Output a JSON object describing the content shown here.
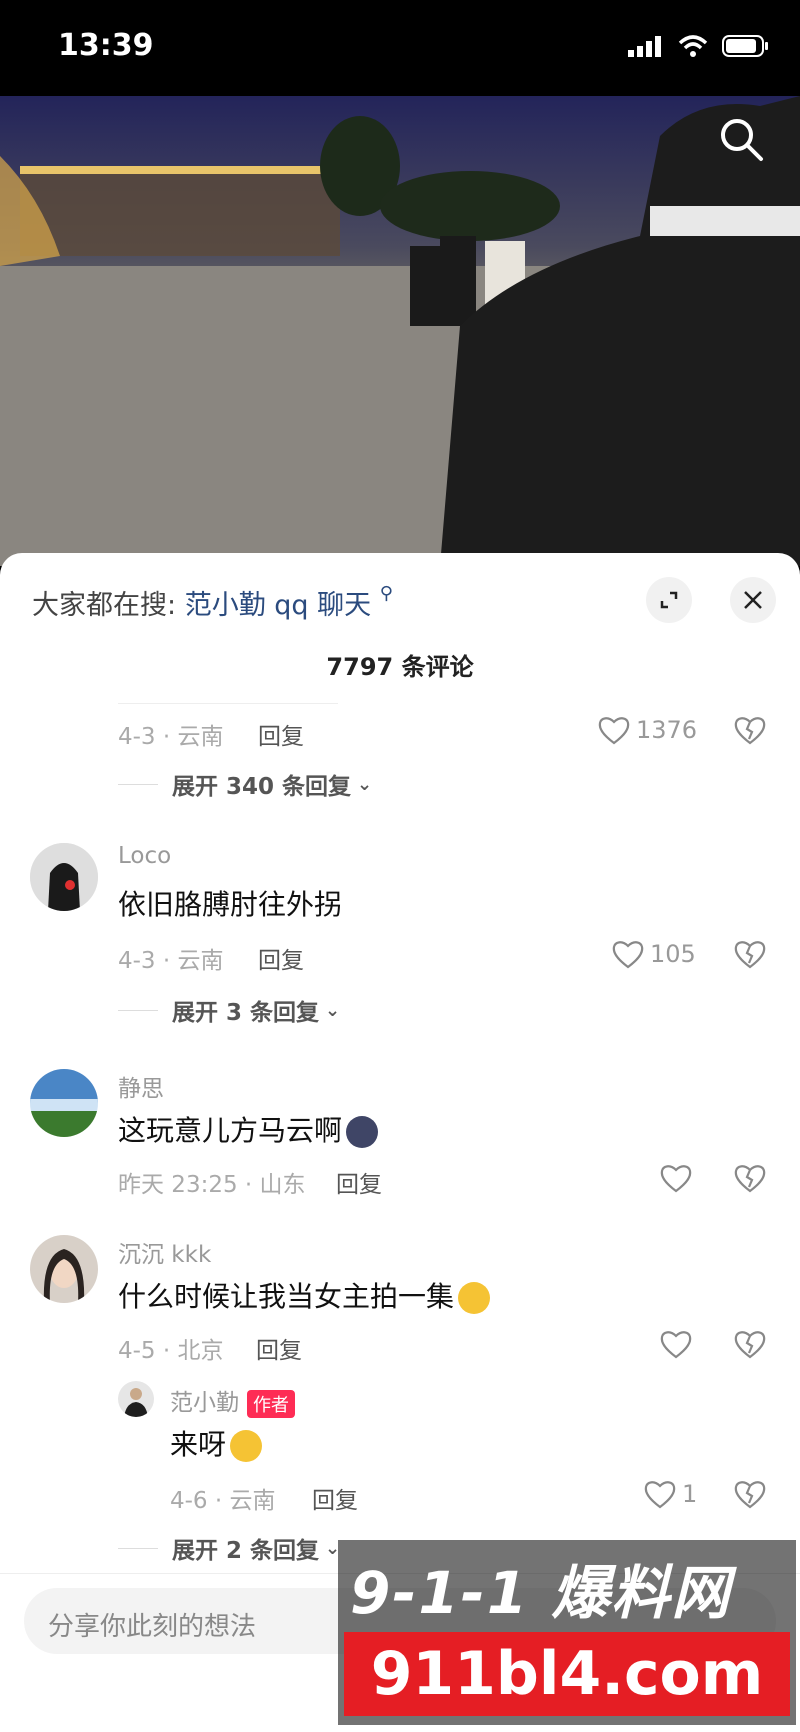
{
  "status": {
    "time": "13:39"
  },
  "search": {
    "prefix": "大家都在搜:",
    "keyword": "范小勤 qq 聊天"
  },
  "comments_header": {
    "count": "7797 条评论"
  },
  "comments": [
    {
      "date_location": "4-3 · 云南",
      "reply": "回复",
      "likes": "1376",
      "expand": "展开 340 条回复"
    },
    {
      "user": "Loco",
      "text": "依旧胳膊肘往外拐",
      "date_location": "4-3 · 云南",
      "reply": "回复",
      "likes": "105",
      "expand": "展开 3 条回复"
    },
    {
      "user": "静思",
      "text": "这玩意儿方马云啊",
      "date_location": "昨天 23:25 · 山东",
      "reply": "回复"
    },
    {
      "user": "沉沉 kkk",
      "text": "什么时候让我当女主拍一集",
      "date_location": "4-5 · 北京",
      "reply": "回复",
      "sub_reply": {
        "user": "范小勤",
        "badge": "作者",
        "text": "来呀",
        "date_location": "4-6 · 云南",
        "reply": "回复",
        "likes": "1"
      },
      "expand": "展开 2 条回复"
    }
  ],
  "composer": {
    "placeholder": "分享你此刻的想法"
  },
  "watermark": {
    "top": "9-1-1 爆料网",
    "bottom": "911bl4.com"
  },
  "colors": {
    "accent_red": "#fe2c55",
    "watermark_red": "#e51e24",
    "link_blue": "#2b4b7e"
  }
}
